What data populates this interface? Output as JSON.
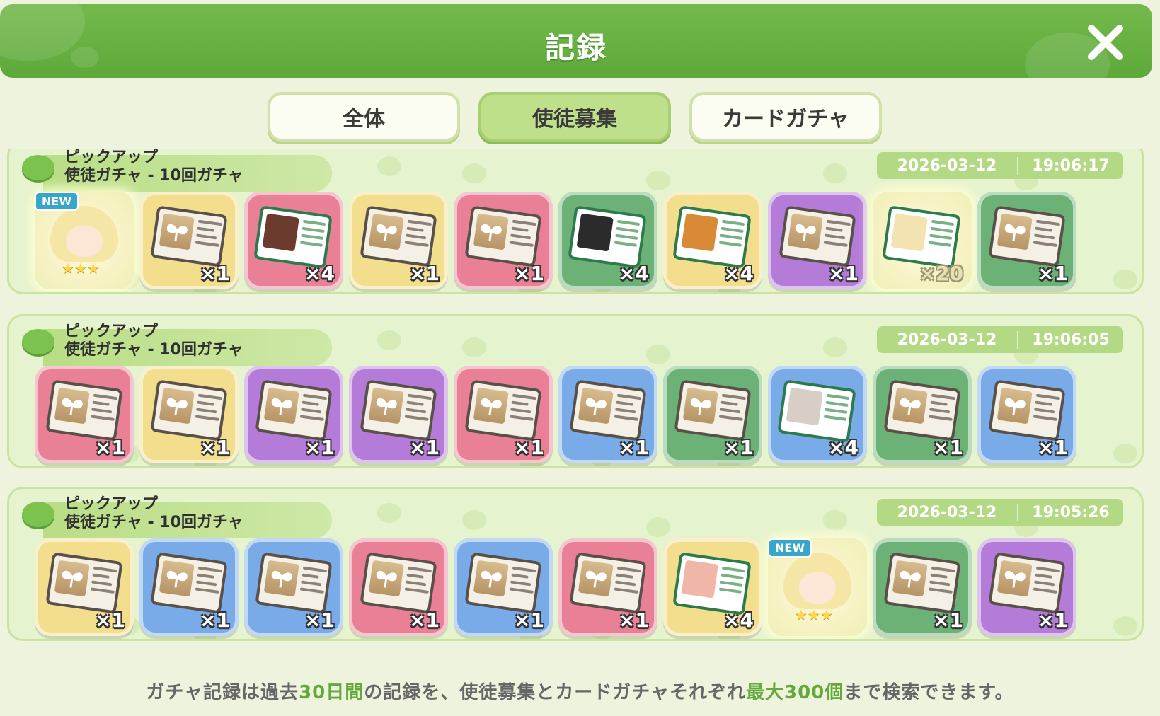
{
  "header": {
    "title": "記録"
  },
  "tabs": [
    {
      "label": "全体",
      "active": false
    },
    {
      "label": "使徒募集",
      "active": true
    },
    {
      "label": "カードガチャ",
      "active": false
    }
  ],
  "colors": {
    "header_green": "#6bb244",
    "panel_bg": "#e6f3cf",
    "accent": "#64a93a",
    "yellow": "#f2de8d",
    "pink": "#e98095",
    "green": "#6cb176",
    "purple": "#b47bd9",
    "blue": "#79abe8"
  },
  "records": [
    {
      "title": "ピックアップ",
      "subtitle": "使徒ガチャ - 10回ガチャ",
      "date": "2026-03-12",
      "time": "19:06:17",
      "items": [
        {
          "kind": "portrait",
          "color": "glow",
          "new": "NEW",
          "qty": ""
        },
        {
          "kind": "ticket",
          "color": "yellow",
          "qty": "×1"
        },
        {
          "kind": "card",
          "color": "pink",
          "face": "#6b3b2e",
          "qty": "×4"
        },
        {
          "kind": "ticket",
          "color": "yellow",
          "qty": "×1"
        },
        {
          "kind": "ticket",
          "color": "pink",
          "qty": "×1"
        },
        {
          "kind": "card",
          "color": "green",
          "face": "#2b2b2b",
          "qty": "×4"
        },
        {
          "kind": "card",
          "color": "yellow",
          "face": "#d98a36",
          "qty": "×4"
        },
        {
          "kind": "ticket",
          "color": "purple",
          "qty": "×1"
        },
        {
          "kind": "card",
          "color": "glow",
          "face": "#f2e3b0",
          "qty": "×20",
          "light": true
        },
        {
          "kind": "ticket",
          "color": "green",
          "qty": "×1"
        }
      ]
    },
    {
      "title": "ピックアップ",
      "subtitle": "使徒ガチャ - 10回ガチャ",
      "date": "2026-03-12",
      "time": "19:06:05",
      "items": [
        {
          "kind": "ticket",
          "color": "pink",
          "qty": "×1"
        },
        {
          "kind": "ticket",
          "color": "yellow",
          "qty": "×1"
        },
        {
          "kind": "ticket",
          "color": "purple",
          "qty": "×1"
        },
        {
          "kind": "ticket",
          "color": "purple",
          "qty": "×1"
        },
        {
          "kind": "ticket",
          "color": "pink",
          "qty": "×1"
        },
        {
          "kind": "ticket",
          "color": "blue",
          "qty": "×1"
        },
        {
          "kind": "ticket",
          "color": "green",
          "qty": "×1"
        },
        {
          "kind": "card",
          "color": "blue",
          "face": "#d7cfc6",
          "qty": "×4"
        },
        {
          "kind": "ticket",
          "color": "green",
          "qty": "×1"
        },
        {
          "kind": "ticket",
          "color": "blue",
          "qty": "×1"
        }
      ]
    },
    {
      "title": "ピックアップ",
      "subtitle": "使徒ガチャ - 10回ガチャ",
      "date": "2026-03-12",
      "time": "19:05:26",
      "items": [
        {
          "kind": "ticket",
          "color": "yellow",
          "qty": "×1"
        },
        {
          "kind": "ticket",
          "color": "blue",
          "qty": "×1"
        },
        {
          "kind": "ticket",
          "color": "blue",
          "qty": "×1"
        },
        {
          "kind": "ticket",
          "color": "pink",
          "qty": "×1"
        },
        {
          "kind": "ticket",
          "color": "blue",
          "qty": "×1"
        },
        {
          "kind": "ticket",
          "color": "pink",
          "qty": "×1"
        },
        {
          "kind": "card",
          "color": "yellow",
          "face": "#f0b7a8",
          "qty": "×4"
        },
        {
          "kind": "portrait",
          "color": "glow",
          "new": "NEW",
          "qty": ""
        },
        {
          "kind": "ticket",
          "color": "green",
          "qty": "×1"
        },
        {
          "kind": "ticket",
          "color": "purple",
          "qty": "×1"
        }
      ]
    }
  ],
  "footer": {
    "part1": "ガチャ記録は過去",
    "hl1": "30日間",
    "part2": "の記録を、使徒募集とカードガチャそれぞれ",
    "hl2": "最大300個",
    "part3": "まで検索できます。"
  },
  "icons": {
    "close": "close-icon",
    "leaf": "leaf-icon",
    "sprout": "sprout-icon"
  }
}
